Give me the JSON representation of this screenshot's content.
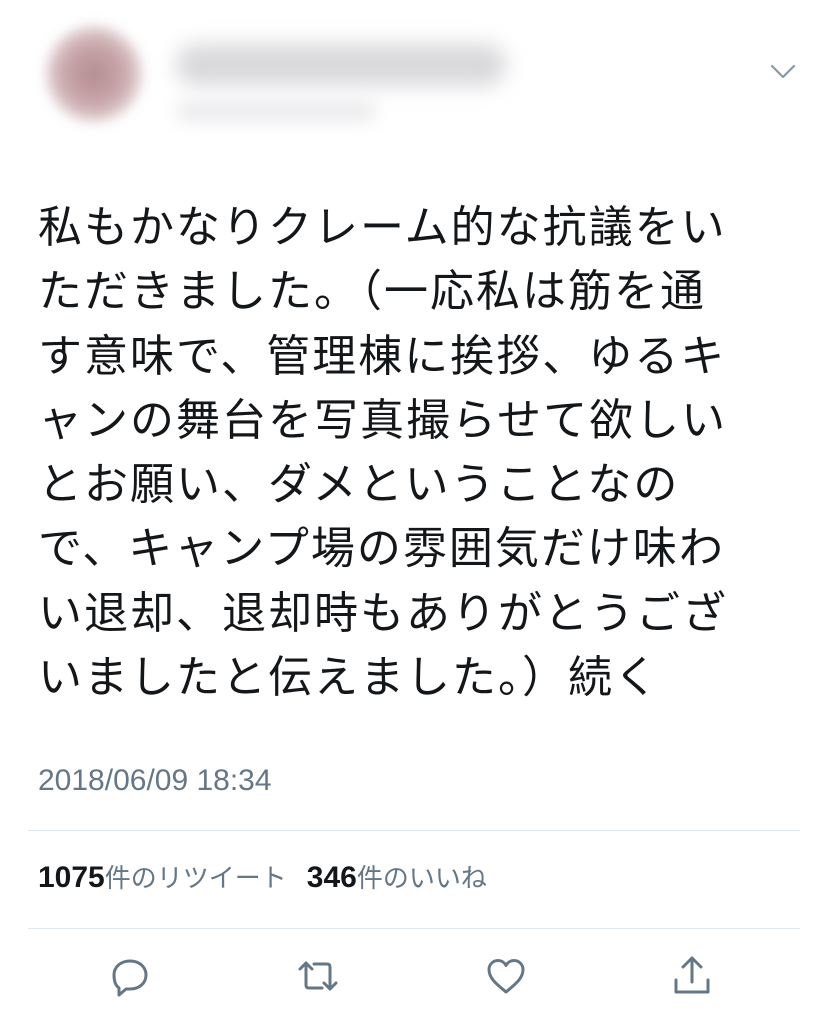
{
  "tweet": {
    "text_lines": [
      "私もかなりクレーム的な抗議をい",
      "ただきました。（一応私は筋を通",
      "す意味で、管理棟に挨拶、ゆるキ",
      "ャンの舞台を写真撮らせて欲しい",
      "とお願い、ダメということなの",
      "で、キャンプ場の雰囲気だけ味わ",
      "い退却、退却時もありがとうござ",
      "いましたと伝えました。）続く"
    ],
    "timestamp": "2018/06/09 18:34"
  },
  "stats": {
    "retweets_count": "1075",
    "retweets_label": "件のリツイート",
    "likes_count": "346",
    "likes_label": "件のいいね"
  },
  "icons": {
    "more": "chevron-down-icon",
    "reply": "reply-icon",
    "retweet": "retweet-icon",
    "like": "heart-icon",
    "share": "share-icon"
  },
  "colors": {
    "text": "#14171a",
    "secondary": "#657786",
    "divider": "#e1e8ed",
    "background": "#ffffff"
  }
}
